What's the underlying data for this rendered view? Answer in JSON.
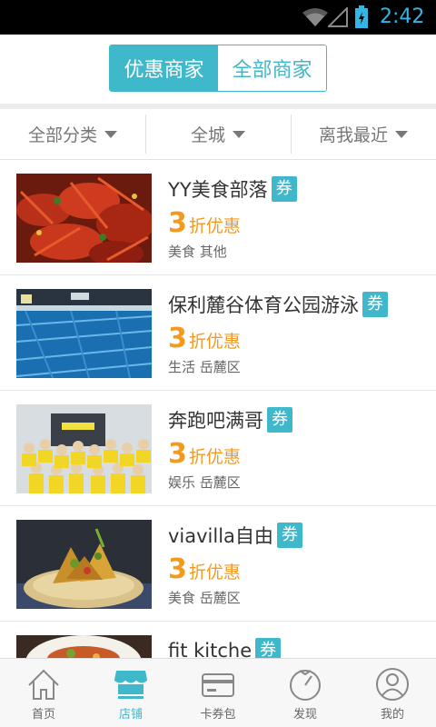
{
  "status_bar": {
    "time": "2:42"
  },
  "segment": {
    "tabs": [
      {
        "label": "优惠商家",
        "active": true
      },
      {
        "label": "全部商家",
        "active": false
      }
    ]
  },
  "filters": [
    {
      "label": "全部分类"
    },
    {
      "label": "全城"
    },
    {
      "label": "离我最近"
    }
  ],
  "coupon_badge": "券",
  "merchants": [
    {
      "name": "YY美食部落",
      "discount_num": "3",
      "discount_text": "折优惠",
      "meta": "美食 其他",
      "image": "crayfish-photo"
    },
    {
      "name": "保利麓谷体育公园游泳",
      "discount_num": "3",
      "discount_text": "折优惠",
      "meta": "生活 岳麓区",
      "image": "swimming-pool-photo"
    },
    {
      "name": "奔跑吧满哥",
      "discount_num": "3",
      "discount_text": "折优惠",
      "meta": "娱乐 岳麓区",
      "image": "group-photo"
    },
    {
      "name": "viavilla自由",
      "discount_num": "3",
      "discount_text": "折优惠",
      "meta": "美食 岳麓区",
      "image": "dish-photo"
    },
    {
      "name": "fit kitche",
      "image": "food-plate-photo"
    }
  ],
  "tabbar": [
    {
      "label": "首页",
      "icon": "home-icon",
      "active": false
    },
    {
      "label": "店铺",
      "icon": "store-icon",
      "active": true
    },
    {
      "label": "卡券包",
      "icon": "card-icon",
      "active": false
    },
    {
      "label": "发现",
      "icon": "compass-icon",
      "active": false
    },
    {
      "label": "我的",
      "icon": "user-icon",
      "active": false
    }
  ],
  "colors": {
    "accent": "#40b8cc",
    "discount": "#f39a1e",
    "status_time": "#33b5e5"
  }
}
